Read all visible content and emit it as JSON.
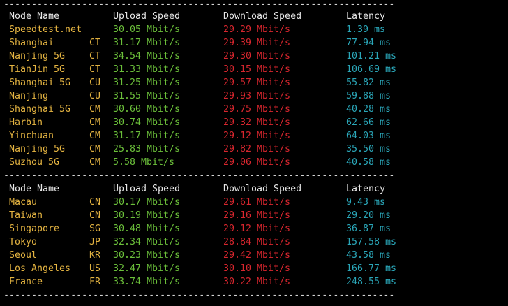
{
  "separator": "----------------------------------------------------------------------",
  "header": {
    "node": "Node Name",
    "upload": "Upload Speed",
    "download": "Download Speed",
    "latency": "Latency"
  },
  "colors": {
    "background": "#000000",
    "header": "#e6e6e6",
    "node_name": "#e3b341",
    "upload": "#6bbf3a",
    "download": "#d8262e",
    "latency": "#2aa6b8"
  },
  "section1": [
    {
      "name": "Speedtest.net",
      "code": "",
      "upload": "30.05 Mbit/s",
      "download": "29.29 Mbit/s",
      "latency": "1.39 ms"
    },
    {
      "name": "Shanghai",
      "code": "CT",
      "upload": "31.17 Mbit/s",
      "download": "29.39 Mbit/s",
      "latency": "77.94 ms"
    },
    {
      "name": "Nanjing 5G",
      "code": "CT",
      "upload": "34.54 Mbit/s",
      "download": "29.30 Mbit/s",
      "latency": "101.21 ms"
    },
    {
      "name": "TianJin 5G",
      "code": "CT",
      "upload": "31.33 Mbit/s",
      "download": "30.15 Mbit/s",
      "latency": "106.69 ms"
    },
    {
      "name": "Shanghai 5G",
      "code": "CU",
      "upload": "31.25 Mbit/s",
      "download": "29.57 Mbit/s",
      "latency": "55.82 ms"
    },
    {
      "name": "Nanjing",
      "code": "CU",
      "upload": "31.55 Mbit/s",
      "download": "29.93 Mbit/s",
      "latency": "59.88 ms"
    },
    {
      "name": "Shanghai 5G",
      "code": "CM",
      "upload": "30.60 Mbit/s",
      "download": "29.75 Mbit/s",
      "latency": "40.28 ms"
    },
    {
      "name": "Harbin",
      "code": "CM",
      "upload": "30.74 Mbit/s",
      "download": "29.32 Mbit/s",
      "latency": "62.66 ms"
    },
    {
      "name": "Yinchuan",
      "code": "CM",
      "upload": "31.17 Mbit/s",
      "download": "29.12 Mbit/s",
      "latency": "64.03 ms"
    },
    {
      "name": "Nanjing 5G",
      "code": "CM",
      "upload": "25.83 Mbit/s",
      "download": "29.82 Mbit/s",
      "latency": "35.50 ms"
    },
    {
      "name": "Suzhou 5G",
      "code": "CM",
      "upload": "5.58 Mbit/s",
      "download": "29.06 Mbit/s",
      "latency": "40.58 ms"
    }
  ],
  "section2": [
    {
      "name": "Macau",
      "code": "CN",
      "upload": "30.17 Mbit/s",
      "download": "29.61 Mbit/s",
      "latency": "9.43 ms"
    },
    {
      "name": "Taiwan",
      "code": "CN",
      "upload": "30.19 Mbit/s",
      "download": "29.16 Mbit/s",
      "latency": "29.20 ms"
    },
    {
      "name": "Singapore",
      "code": "SG",
      "upload": "30.48 Mbit/s",
      "download": "29.12 Mbit/s",
      "latency": "36.87 ms"
    },
    {
      "name": "Tokyo",
      "code": "JP",
      "upload": "32.34 Mbit/s",
      "download": "28.84 Mbit/s",
      "latency": "157.58 ms"
    },
    {
      "name": "Seoul",
      "code": "KR",
      "upload": "30.23 Mbit/s",
      "download": "29.42 Mbit/s",
      "latency": "43.58 ms"
    },
    {
      "name": "Los Angeles",
      "code": "US",
      "upload": "32.47 Mbit/s",
      "download": "30.10 Mbit/s",
      "latency": "166.77 ms"
    },
    {
      "name": "France",
      "code": "FR",
      "upload": "33.74 Mbit/s",
      "download": "30.22 Mbit/s",
      "latency": "248.55 ms"
    }
  ]
}
